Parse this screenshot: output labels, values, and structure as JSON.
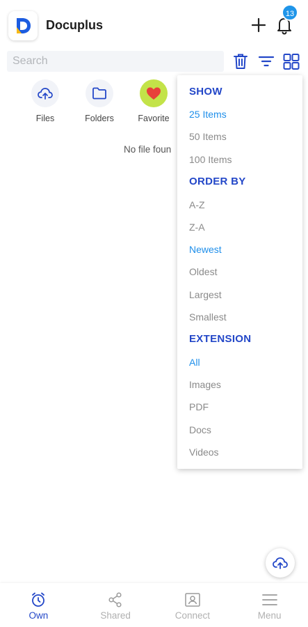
{
  "app": {
    "title": "Docuplus",
    "notification_count": "13"
  },
  "search": {
    "placeholder": "Search",
    "value": ""
  },
  "toolbar": {
    "icons": [
      "trash-icon",
      "filter-icon",
      "grid-view-icon"
    ]
  },
  "categories": [
    {
      "label": "Files",
      "icon": "cloud-upload-icon"
    },
    {
      "label": "Folders",
      "icon": "folder-icon"
    },
    {
      "label": "Favorite",
      "icon": "heart-icon"
    }
  ],
  "empty_message": "No file foun",
  "filter_menu": {
    "show": {
      "title": "SHOW",
      "items": [
        "25 Items",
        "50 Items",
        "100 Items"
      ],
      "selected": "25 Items"
    },
    "order_by": {
      "title": "ORDER BY",
      "items": [
        "A-Z",
        "Z-A",
        "Newest",
        "Oldest",
        "Largest",
        "Smallest"
      ],
      "selected": "Newest"
    },
    "extension": {
      "title": "EXTENSION",
      "items": [
        "All",
        "Images",
        "PDF",
        "Docs",
        "Videos"
      ],
      "selected": "All"
    }
  },
  "bottom_nav": [
    {
      "label": "Own",
      "icon": "alarm-clock-icon",
      "active": true
    },
    {
      "label": "Shared",
      "icon": "share-icon",
      "active": false
    },
    {
      "label": "Connect",
      "icon": "contact-card-icon",
      "active": false
    },
    {
      "label": "Menu",
      "icon": "hamburger-menu-icon",
      "active": false
    }
  ],
  "colors": {
    "accent_blue": "#2347c8",
    "selected_blue": "#1f8fea",
    "badge_blue": "#1f95e9",
    "favorite_bg": "#c3e349",
    "heart_red": "#e8403a"
  }
}
